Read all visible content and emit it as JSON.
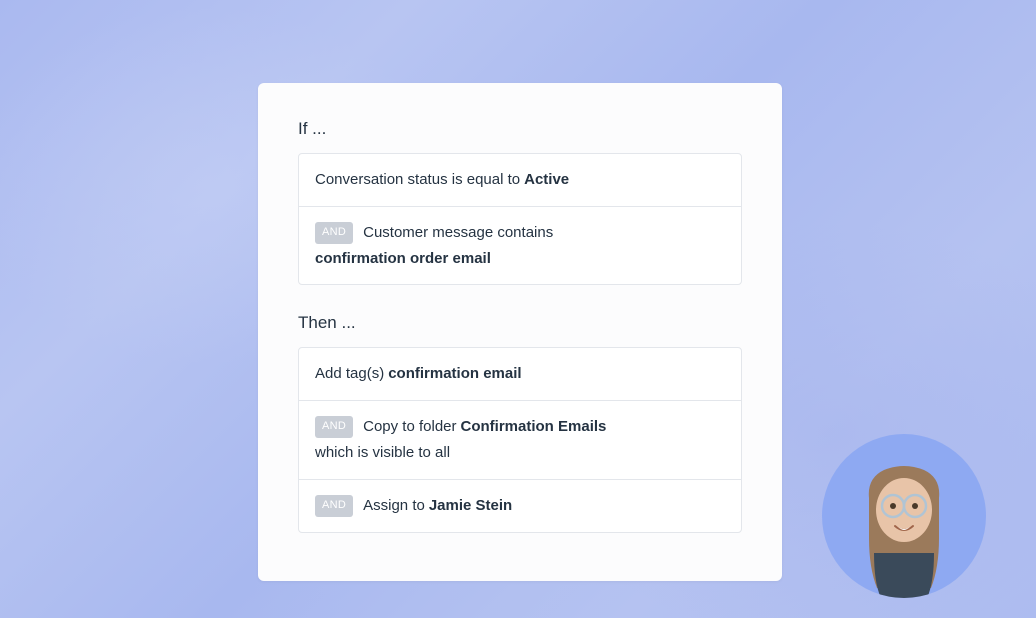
{
  "if_label": "If ...",
  "then_label": "Then ...",
  "and_label": "AND",
  "conditions": [
    {
      "prefix": "Conversation status is equal to ",
      "bold": "Active",
      "suffix": ""
    },
    {
      "prefix": "Customer message contains ",
      "bold": "confirmation order email",
      "suffix": ""
    }
  ],
  "actions": [
    {
      "prefix": "Add tag(s) ",
      "bold": "confirmation email",
      "suffix": ""
    },
    {
      "prefix": "Copy to folder ",
      "bold": "Confirmation Emails",
      "suffix": " which is visible to all"
    },
    {
      "prefix": "Assign to ",
      "bold": "Jamie Stein",
      "suffix": ""
    }
  ]
}
